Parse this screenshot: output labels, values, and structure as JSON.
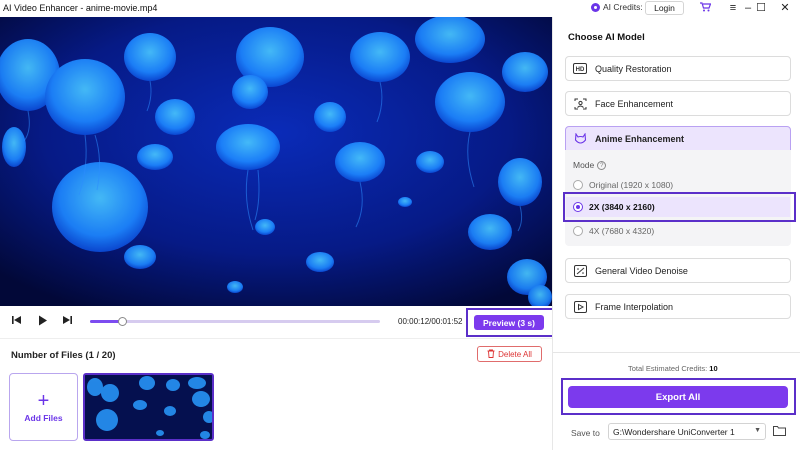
{
  "window": {
    "title": "AI Video Enhancer - anime-movie.mp4",
    "credits_label": "AI Credits:",
    "login_label": "Login",
    "icons": [
      "credits-icon",
      "cart-icon",
      "menu-icon",
      "minimize-icon",
      "maximize-icon",
      "close-icon"
    ]
  },
  "player": {
    "timecode": "00:00:12/00:01:52",
    "progress": 0.11,
    "preview_label": "Preview (3 s)"
  },
  "files": {
    "count_label": "Number of Files (1 / 20)",
    "delete_all_label": "Delete All",
    "add_files_label": "Add Files"
  },
  "panel": {
    "title": "Choose AI Model",
    "models": [
      {
        "label": "Quality Restoration",
        "icon": "hd-icon"
      },
      {
        "label": "Face Enhancement",
        "icon": "face-scan-icon"
      },
      {
        "label": "Anime Enhancement",
        "icon": "anime-icon",
        "active": true
      },
      {
        "label": "General Video Denoise",
        "icon": "denoise-icon"
      },
      {
        "label": "Frame Interpolation",
        "icon": "frame-icon"
      }
    ],
    "mode_label": "Mode",
    "mode_options": [
      {
        "label": "Original (1920 x 1080)",
        "selected": false
      },
      {
        "label": "2X (3840 x 2160)",
        "selected": true
      },
      {
        "label": "4X (7680 x 4320)",
        "selected": false
      }
    ],
    "total_credits_label": "Total Estimated Credits:",
    "total_credits_value": "10",
    "export_label": "Export All",
    "save_to_label": "Save to",
    "save_path": "G:\\Wondershare UniConverter 1"
  },
  "colors": {
    "accent": "#7c3aed",
    "highlight_border": "#5b2fc9",
    "video_bg": "#020838"
  }
}
